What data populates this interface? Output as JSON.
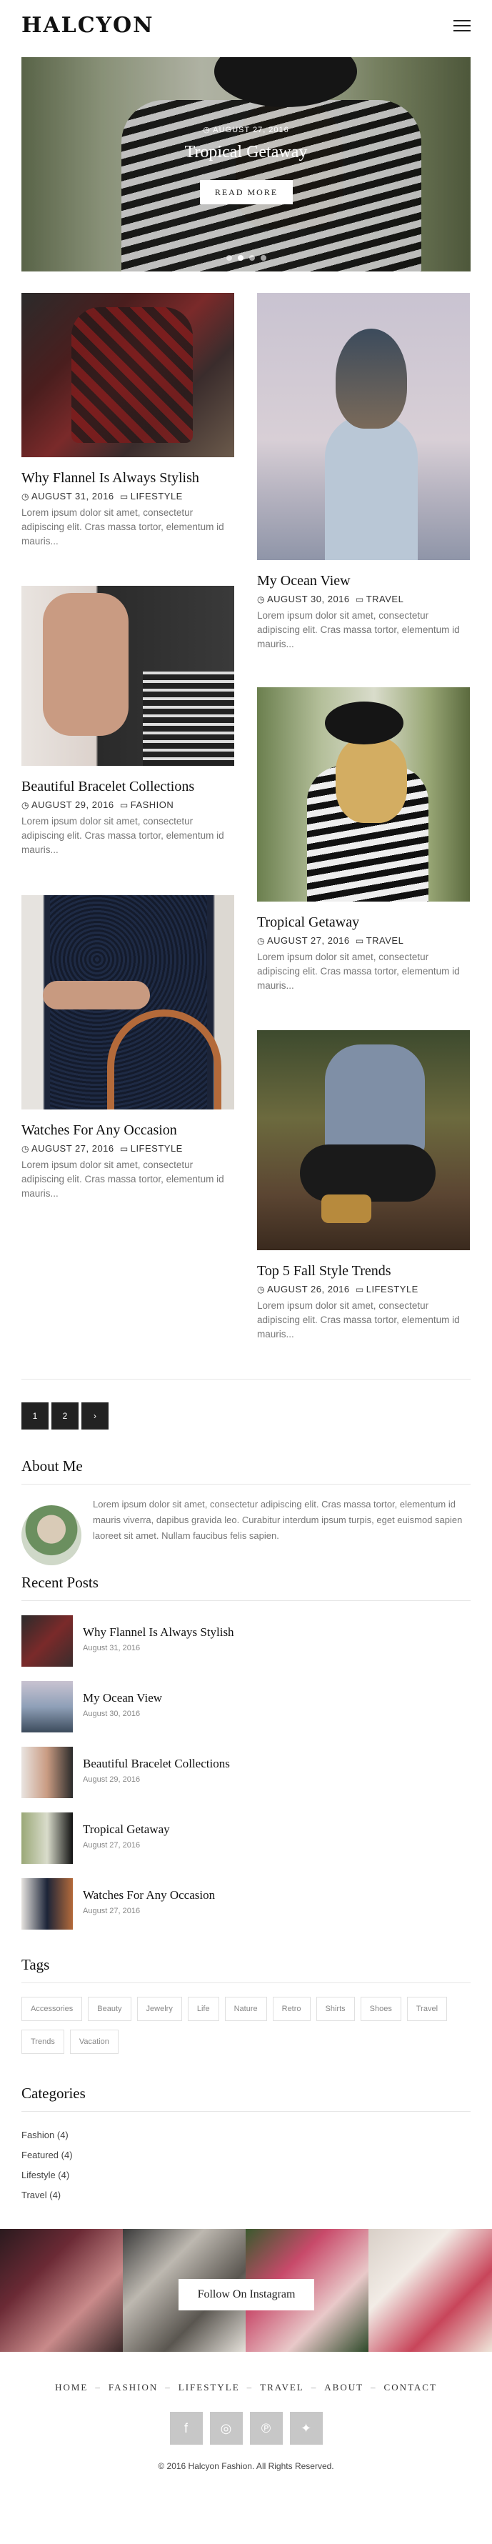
{
  "site": {
    "logo": "HALCYON"
  },
  "hero": {
    "date": "AUGUST 27, 2016",
    "title": "Tropical Getaway",
    "button": "READ MORE",
    "slides": 4,
    "active_slide": 2
  },
  "posts": [
    {
      "title": "Why Flannel Is Always Stylish",
      "date": "AUGUST 31, 2016",
      "category": "LIFESTYLE",
      "excerpt": "Lorem ipsum dolor sit amet, consectetur adipiscing elit. Cras massa tortor, elementum id mauris..."
    },
    {
      "title": "My Ocean View",
      "date": "AUGUST 30, 2016",
      "category": "TRAVEL",
      "excerpt": "Lorem ipsum dolor sit amet, consectetur adipiscing elit. Cras massa tortor, elementum id mauris..."
    },
    {
      "title": "Beautiful Bracelet Collections",
      "date": "AUGUST 29, 2016",
      "category": "FASHION",
      "excerpt": "Lorem ipsum dolor sit amet, consectetur adipiscing elit. Cras massa tortor, elementum id mauris..."
    },
    {
      "title": "Tropical Getaway",
      "date": "AUGUST 27, 2016",
      "category": "TRAVEL",
      "excerpt": "Lorem ipsum dolor sit amet, consectetur adipiscing elit. Cras massa tortor, elementum id mauris..."
    },
    {
      "title": "Watches For Any Occasion",
      "date": "AUGUST 27, 2016",
      "category": "LIFESTYLE",
      "excerpt": "Lorem ipsum dolor sit amet, consectetur adipiscing elit. Cras massa tortor, elementum id mauris..."
    },
    {
      "title": "Top 5 Fall Style Trends",
      "date": "AUGUST 26, 2016",
      "category": "LIFESTYLE",
      "excerpt": "Lorem ipsum dolor sit amet, consectetur adipiscing elit. Cras massa tortor, elementum id mauris..."
    }
  ],
  "pagination": {
    "pages": [
      "1",
      "2"
    ],
    "next": "›"
  },
  "about": {
    "title": "About Me",
    "text": "Lorem ipsum dolor sit amet, consectetur adipiscing elit. Cras massa tortor, elementum id mauris viverra, dapibus gravida leo. Curabitur interdum ipsum turpis, eget euismod sapien laoreet sit amet. Nullam faucibus felis sapien."
  },
  "recent": {
    "title": "Recent Posts",
    "items": [
      {
        "title": "Why Flannel Is Always Stylish",
        "date": "August 31, 2016"
      },
      {
        "title": "My Ocean View",
        "date": "August 30, 2016"
      },
      {
        "title": "Beautiful Bracelet Collections",
        "date": "August 29, 2016"
      },
      {
        "title": "Tropical Getaway",
        "date": "August 27, 2016"
      },
      {
        "title": "Watches For Any Occasion",
        "date": "August 27, 2016"
      }
    ]
  },
  "tags": {
    "title": "Tags",
    "items": [
      "Accessories",
      "Beauty",
      "Jewelry",
      "Life",
      "Nature",
      "Retro",
      "Shirts",
      "Shoes",
      "Travel",
      "Trends",
      "Vacation"
    ]
  },
  "categories": {
    "title": "Categories",
    "items": [
      "Fashion (4)",
      "Featured (4)",
      "Lifestyle (4)",
      "Travel (4)"
    ]
  },
  "instagram": {
    "button": "Follow On Instagram"
  },
  "footer": {
    "nav": [
      "HOME",
      "FASHION",
      "LIFESTYLE",
      "TRAVEL",
      "ABOUT",
      "CONTACT"
    ],
    "separator": "–",
    "socials": [
      {
        "icon": "facebook-icon",
        "glyph": "f"
      },
      {
        "icon": "instagram-icon",
        "glyph": "◎"
      },
      {
        "icon": "pinterest-icon",
        "glyph": "℗"
      },
      {
        "icon": "twitter-icon",
        "glyph": "✦"
      }
    ],
    "copyright": "© 2016 Halcyon Fashion. All Rights Reserved."
  },
  "colors": {
    "text": "#222222",
    "muted": "#777777",
    "button_dark": "#222222",
    "social_bg": "#c7c7c7"
  }
}
